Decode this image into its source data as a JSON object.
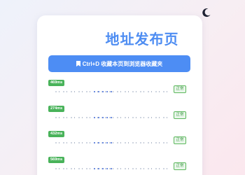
{
  "page": {
    "title": "地址发布页"
  },
  "bookmark_button": {
    "label": "Ctrl+D 收藏本页到浏览器收藏夹"
  },
  "theme_toggle": {
    "icon": "moon-icon"
  },
  "addresses": [
    {
      "latency": "469ms",
      "url": "",
      "status": "正常"
    },
    {
      "latency": "274ms",
      "url": "",
      "status": "正常"
    },
    {
      "latency": "432ms",
      "url": "",
      "status": "正常"
    },
    {
      "latency": "569ms",
      "url": "",
      "status": "正常"
    }
  ],
  "colors": {
    "accent": "#4d8df4",
    "latency_badge": "#49b35a",
    "status_ok": "#3f9a47"
  }
}
